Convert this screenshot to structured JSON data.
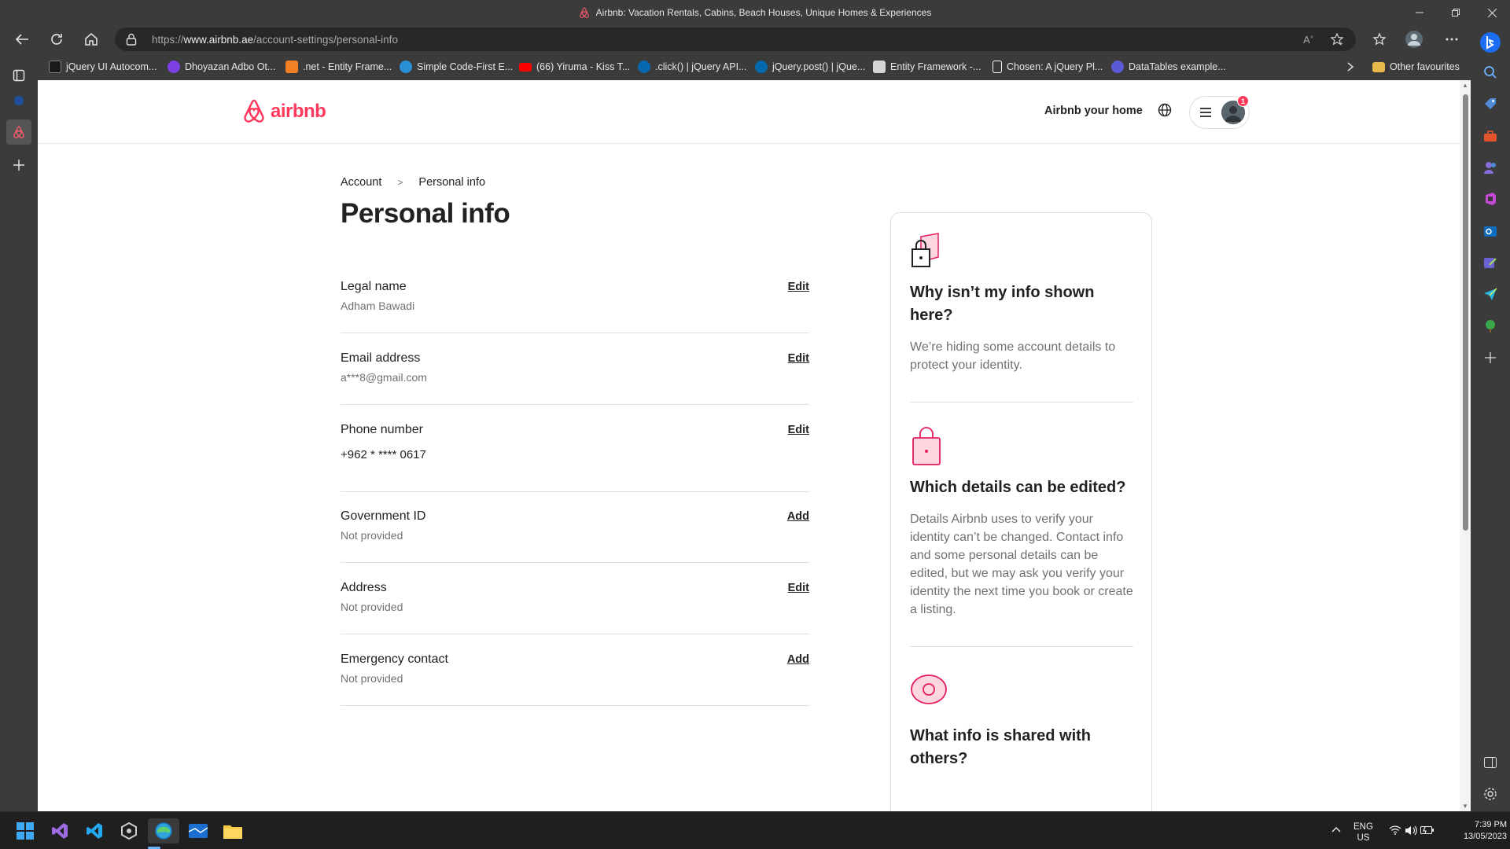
{
  "browser": {
    "window_title": "Airbnb: Vacation Rentals, Cabins, Beach Houses, Unique Homes & Experiences",
    "url_prefix": "https://",
    "url_domain": "www.airbnb.ae",
    "url_path": "/account-settings/personal-info",
    "bookmarks": [
      {
        "label": "jQuery UI Autocom...",
        "color": "#1a1a1a"
      },
      {
        "label": "Dhoyazan Adbo Ot...",
        "color": "#7b3fe4"
      },
      {
        "label": ".net - Entity Frame...",
        "color": "#f48024"
      },
      {
        "label": "Simple Code-First E...",
        "color": "#2a8fd6"
      },
      {
        "label": "(66) Yiruma - Kiss T...",
        "color": "#ff0000"
      },
      {
        "label": ".click() | jQuery API...",
        "color": "#0769ad"
      },
      {
        "label": "jQuery.post() | jQue...",
        "color": "#0769ad"
      },
      {
        "label": "Entity Framework -...",
        "color": "#d6d6d6"
      },
      {
        "label": "Chosen: A jQuery Pl...",
        "color": "#ffffff"
      },
      {
        "label": "DataTables example...",
        "color": "#5a5ad6"
      }
    ],
    "other_favourites": "Other favourites"
  },
  "airbnb": {
    "logo_text": "airbnb",
    "host_link": "Airbnb your home",
    "notification_count": "1",
    "brand_color": "#ff385c"
  },
  "page": {
    "breadcrumb": [
      "Account",
      "Personal info"
    ],
    "title": "Personal info",
    "rows": [
      {
        "label": "Legal name",
        "value": "Adham Bawadi",
        "action": "Edit"
      },
      {
        "label": "Email address",
        "value": "a***8@gmail.com",
        "action": "Edit"
      },
      {
        "label": "Phone number",
        "value": "+962 * **** 0617",
        "action": "Edit"
      },
      {
        "label": "Government ID",
        "value": "Not provided",
        "action": "Add"
      },
      {
        "label": "Address",
        "value": "Not provided",
        "action": "Edit"
      },
      {
        "label": "Emergency contact",
        "value": "Not provided",
        "action": "Add"
      }
    ],
    "card": [
      {
        "title": "Why isn’t my info shown here?",
        "body": "We’re hiding some account details to protect your identity.",
        "icon": "lock-icon"
      },
      {
        "title": "Which details can be edited?",
        "body": "Details Airbnb uses to verify your identity can’t be changed. Contact info and some personal details can be edited, but we may ask you verify your identity the next time you book or create a listing.",
        "icon": "bag-icon"
      },
      {
        "title": "What info is shared with others?",
        "body": "",
        "icon": "eye-icon"
      }
    ]
  },
  "taskbar": {
    "lang_top": "ENG",
    "lang_bottom": "US",
    "time": "7:39 PM",
    "date": "13/05/2023"
  }
}
